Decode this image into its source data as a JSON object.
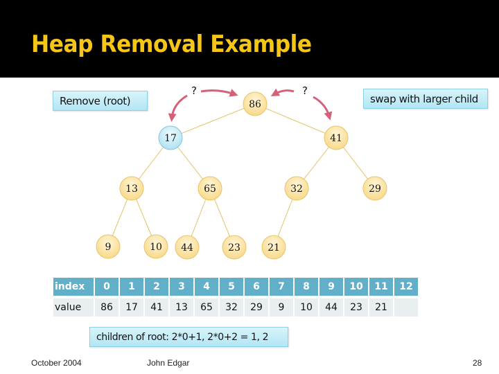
{
  "slide": {
    "title": "Heap Removal Example",
    "callouts": {
      "remove": "Remove (root)",
      "swap": "swap with larger child",
      "children": "children of root: 2*0+1, 2*0+2 = 1, 2"
    },
    "question_marks": [
      "?",
      "?"
    ],
    "footer": {
      "date": "October 2004",
      "author": "John Edgar",
      "page": "28"
    },
    "colors": {
      "title": "#f5c518",
      "node_default": "#fbe3a3",
      "node_highlight": "#c9ecf7",
      "arrow": "#d4617a",
      "edge": "#e2c46a",
      "table_header": "#61afc9",
      "table_value": "#e9eef1"
    }
  },
  "tree": {
    "nodes": [
      {
        "id": 0,
        "value": "86",
        "style": "default"
      },
      {
        "id": 1,
        "value": "17",
        "style": "highlight"
      },
      {
        "id": 2,
        "value": "41",
        "style": "default"
      },
      {
        "id": 3,
        "value": "13",
        "style": "default"
      },
      {
        "id": 4,
        "value": "65",
        "style": "default"
      },
      {
        "id": 5,
        "value": "32",
        "style": "default"
      },
      {
        "id": 6,
        "value": "29",
        "style": "default"
      },
      {
        "id": 7,
        "value": "9",
        "style": "default"
      },
      {
        "id": 8,
        "value": "10",
        "style": "default"
      },
      {
        "id": 9,
        "value": "44",
        "style": "default"
      },
      {
        "id": 10,
        "value": "23",
        "style": "default"
      },
      {
        "id": 11,
        "value": "21",
        "style": "default"
      }
    ],
    "edges": [
      [
        0,
        1
      ],
      [
        0,
        2
      ],
      [
        1,
        3
      ],
      [
        1,
        4
      ],
      [
        2,
        5
      ],
      [
        2,
        6
      ],
      [
        3,
        7
      ],
      [
        3,
        8
      ],
      [
        4,
        9
      ],
      [
        4,
        10
      ],
      [
        5,
        11
      ]
    ]
  },
  "array": {
    "index_label": "index",
    "value_label": "value",
    "indices": [
      "0",
      "1",
      "2",
      "3",
      "4",
      "5",
      "6",
      "7",
      "8",
      "9",
      "10",
      "11",
      "12"
    ],
    "values": [
      "86",
      "17",
      "41",
      "13",
      "65",
      "32",
      "29",
      "9",
      "10",
      "44",
      "23",
      "21",
      ""
    ]
  }
}
